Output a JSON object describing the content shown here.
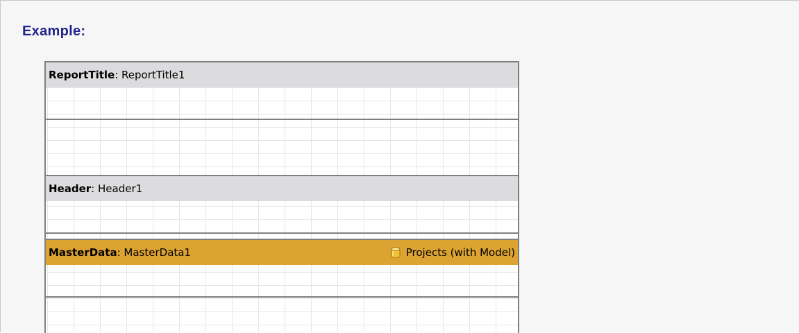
{
  "example_label": "Example:",
  "bands": [
    {
      "type": "ReportTitle",
      "name": "ReportTitle1"
    },
    {
      "type": "Header",
      "name": "Header1"
    },
    {
      "type": "MasterData",
      "name": "MasterData1",
      "datasource": "Projects (with Model)"
    }
  ],
  "colors": {
    "band_header": "#dcdcde",
    "master_header": "#dca232",
    "example_text": "#23238c"
  },
  "icons": {
    "datasource": "database-icon"
  }
}
